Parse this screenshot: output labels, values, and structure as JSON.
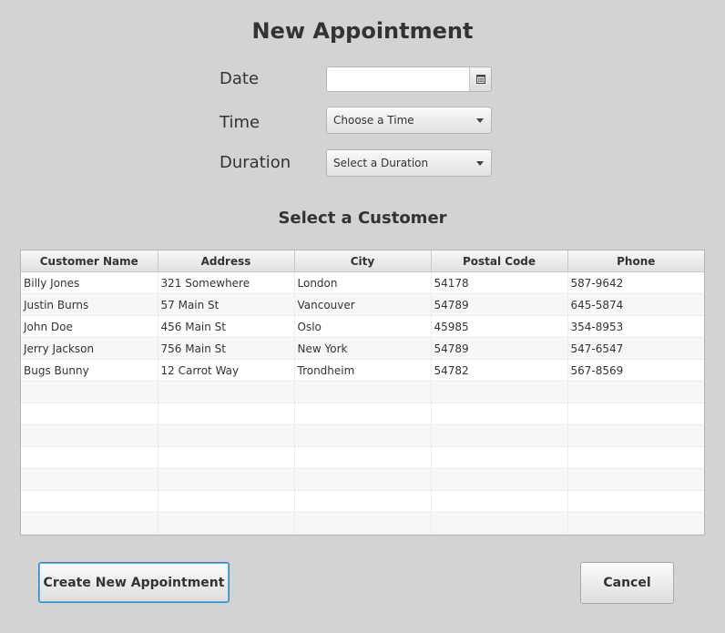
{
  "title": "New Appointment",
  "form": {
    "date_label": "Date",
    "date_value": "",
    "date_placeholder": "",
    "time_label": "Time",
    "time_selected": "Choose a Time",
    "duration_label": "Duration",
    "duration_selected": "Select a Duration"
  },
  "customers": {
    "heading": "Select a Customer",
    "columns": [
      "Customer Name",
      "Address",
      "City",
      "Postal Code",
      "Phone"
    ],
    "rows": [
      [
        "Billy Jones",
        "321 Somewhere",
        "London",
        "54178",
        "587-9642"
      ],
      [
        "Justin Burns",
        "57 Main St",
        "Vancouver",
        "54789",
        "645-5874"
      ],
      [
        "John Doe",
        "456 Main St",
        "Oslo",
        "45985",
        "354-8953"
      ],
      [
        "Jerry Jackson",
        "756 Main St",
        "New York",
        "54789",
        "547-6547"
      ],
      [
        "Bugs Bunny",
        "12 Carrot Way",
        "Trondheim",
        "54782",
        "567-8569"
      ]
    ]
  },
  "actions": {
    "create_label": "Create New Appointment",
    "cancel_label": "Cancel"
  },
  "icons": {
    "calendar": "calendar-icon",
    "dropdown": "chevron-down-icon"
  },
  "colors": {
    "background": "#d3d3d3",
    "default_button_border": "#2b8bc2"
  }
}
